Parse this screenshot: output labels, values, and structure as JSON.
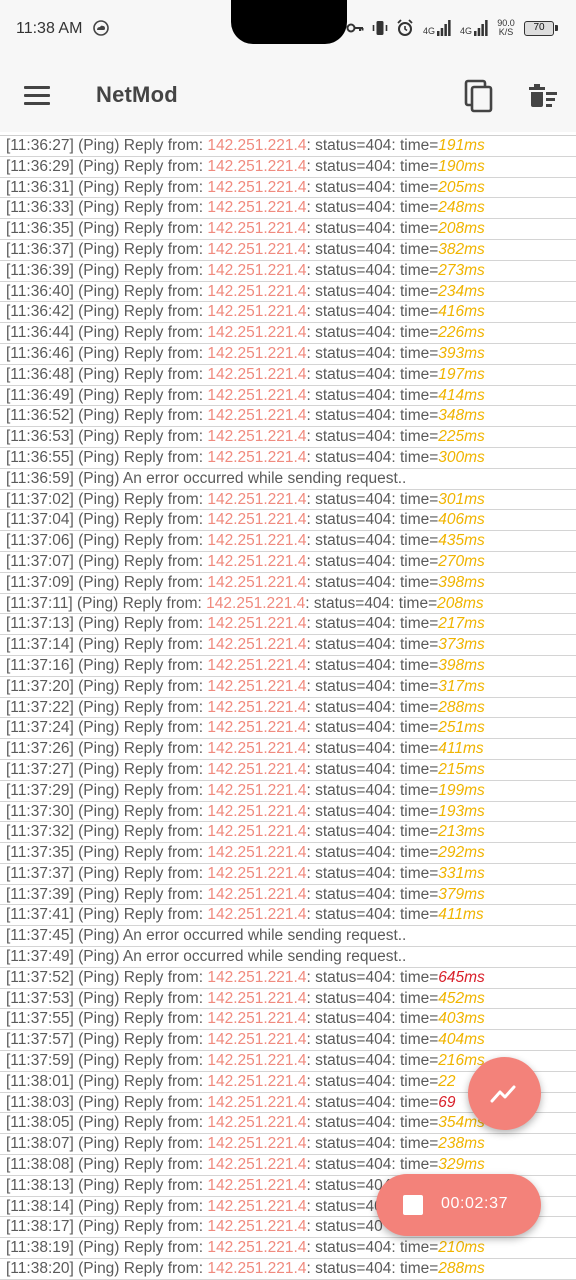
{
  "status_bar": {
    "time": "11:38 AM",
    "net_speed_value": "90.0",
    "net_speed_unit": "K/S",
    "signal1_label": "4G",
    "signal2_label": "4G",
    "battery": "70",
    "icons": [
      "cloud-icon",
      "key-icon",
      "vibrate-icon",
      "alarm-icon",
      "signal-icon",
      "battery-icon"
    ]
  },
  "app_bar": {
    "title": "NetMod",
    "icons": [
      "menu-icon",
      "copy-icon",
      "delete-sweep-icon"
    ]
  },
  "log": {
    "entries": [
      {
        "ts": "[11:36:27]",
        "pre": " (Ping) Reply from: ",
        "ip": "142.251.221.4",
        "mid": ": status=404: time=",
        "ms": "191ms",
        "slow": false
      },
      {
        "ts": "[11:36:29]",
        "pre": " (Ping) Reply from: ",
        "ip": "142.251.221.4",
        "mid": ": status=404: time=",
        "ms": "190ms",
        "slow": false
      },
      {
        "ts": "[11:36:31]",
        "pre": " (Ping) Reply from: ",
        "ip": "142.251.221.4",
        "mid": ": status=404: time=",
        "ms": "205ms",
        "slow": false
      },
      {
        "ts": "[11:36:33]",
        "pre": " (Ping) Reply from: ",
        "ip": "142.251.221.4",
        "mid": ": status=404: time=",
        "ms": "248ms",
        "slow": false
      },
      {
        "ts": "[11:36:35]",
        "pre": " (Ping) Reply from: ",
        "ip": "142.251.221.4",
        "mid": ": status=404: time=",
        "ms": "208ms",
        "slow": false
      },
      {
        "ts": "[11:36:37]",
        "pre": " (Ping) Reply from: ",
        "ip": "142.251.221.4",
        "mid": ": status=404: time=",
        "ms": "382ms",
        "slow": false
      },
      {
        "ts": "[11:36:39]",
        "pre": " (Ping) Reply from: ",
        "ip": "142.251.221.4",
        "mid": ": status=404: time=",
        "ms": "273ms",
        "slow": false
      },
      {
        "ts": "[11:36:40]",
        "pre": " (Ping) Reply from: ",
        "ip": "142.251.221.4",
        "mid": ": status=404: time=",
        "ms": "234ms",
        "slow": false
      },
      {
        "ts": "[11:36:42]",
        "pre": " (Ping) Reply from: ",
        "ip": "142.251.221.4",
        "mid": ": status=404: time=",
        "ms": "416ms",
        "slow": false
      },
      {
        "ts": "[11:36:44]",
        "pre": " (Ping) Reply from: ",
        "ip": "142.251.221.4",
        "mid": ": status=404: time=",
        "ms": "226ms",
        "slow": false
      },
      {
        "ts": "[11:36:46]",
        "pre": " (Ping) Reply from: ",
        "ip": "142.251.221.4",
        "mid": ": status=404: time=",
        "ms": "393ms",
        "slow": false
      },
      {
        "ts": "[11:36:48]",
        "pre": " (Ping) Reply from: ",
        "ip": "142.251.221.4",
        "mid": ": status=404: time=",
        "ms": "197ms",
        "slow": false
      },
      {
        "ts": "[11:36:49]",
        "pre": " (Ping) Reply from: ",
        "ip": "142.251.221.4",
        "mid": ": status=404: time=",
        "ms": "414ms",
        "slow": false
      },
      {
        "ts": "[11:36:52]",
        "pre": " (Ping) Reply from: ",
        "ip": "142.251.221.4",
        "mid": ": status=404: time=",
        "ms": "348ms",
        "slow": false
      },
      {
        "ts": "[11:36:53]",
        "pre": " (Ping) Reply from: ",
        "ip": "142.251.221.4",
        "mid": ": status=404: time=",
        "ms": "225ms",
        "slow": false
      },
      {
        "ts": "[11:36:55]",
        "pre": " (Ping) Reply from: ",
        "ip": "142.251.221.4",
        "mid": ": status=404: time=",
        "ms": "300ms",
        "slow": false
      },
      {
        "ts": "[11:36:59]",
        "pre": " (Ping) An error occurred while sending request..",
        "ip": "",
        "mid": "",
        "ms": "",
        "slow": false
      },
      {
        "ts": "[11:37:02]",
        "pre": " (Ping) Reply from: ",
        "ip": "142.251.221.4",
        "mid": ": status=404: time=",
        "ms": "301ms",
        "slow": false
      },
      {
        "ts": "[11:37:04]",
        "pre": " (Ping) Reply from: ",
        "ip": "142.251.221.4",
        "mid": ": status=404: time=",
        "ms": "406ms",
        "slow": false
      },
      {
        "ts": "[11:37:06]",
        "pre": " (Ping) Reply from: ",
        "ip": "142.251.221.4",
        "mid": ": status=404: time=",
        "ms": "435ms",
        "slow": false
      },
      {
        "ts": "[11:37:07]",
        "pre": " (Ping) Reply from: ",
        "ip": "142.251.221.4",
        "mid": ": status=404: time=",
        "ms": "270ms",
        "slow": false
      },
      {
        "ts": "[11:37:09]",
        "pre": " (Ping) Reply from: ",
        "ip": "142.251.221.4",
        "mid": ": status=404: time=",
        "ms": "398ms",
        "slow": false
      },
      {
        "ts": "[11:37:11]",
        "pre": " (Ping) Reply from: ",
        "ip": "142.251.221.4",
        "mid": ": status=404: time=",
        "ms": "208ms",
        "slow": false
      },
      {
        "ts": "[11:37:13]",
        "pre": " (Ping) Reply from: ",
        "ip": "142.251.221.4",
        "mid": ": status=404: time=",
        "ms": "217ms",
        "slow": false
      },
      {
        "ts": "[11:37:14]",
        "pre": " (Ping) Reply from: ",
        "ip": "142.251.221.4",
        "mid": ": status=404: time=",
        "ms": "373ms",
        "slow": false
      },
      {
        "ts": "[11:37:16]",
        "pre": " (Ping) Reply from: ",
        "ip": "142.251.221.4",
        "mid": ": status=404: time=",
        "ms": "398ms",
        "slow": false
      },
      {
        "ts": "[11:37:20]",
        "pre": " (Ping) Reply from: ",
        "ip": "142.251.221.4",
        "mid": ": status=404: time=",
        "ms": "317ms",
        "slow": false
      },
      {
        "ts": "[11:37:22]",
        "pre": " (Ping) Reply from: ",
        "ip": "142.251.221.4",
        "mid": ": status=404: time=",
        "ms": "288ms",
        "slow": false
      },
      {
        "ts": "[11:37:24]",
        "pre": " (Ping) Reply from: ",
        "ip": "142.251.221.4",
        "mid": ": status=404: time=",
        "ms": "251ms",
        "slow": false
      },
      {
        "ts": "[11:37:26]",
        "pre": " (Ping) Reply from: ",
        "ip": "142.251.221.4",
        "mid": ": status=404: time=",
        "ms": "411ms",
        "slow": false
      },
      {
        "ts": "[11:37:27]",
        "pre": " (Ping) Reply from: ",
        "ip": "142.251.221.4",
        "mid": ": status=404: time=",
        "ms": "215ms",
        "slow": false
      },
      {
        "ts": "[11:37:29]",
        "pre": " (Ping) Reply from: ",
        "ip": "142.251.221.4",
        "mid": ": status=404: time=",
        "ms": "199ms",
        "slow": false
      },
      {
        "ts": "[11:37:30]",
        "pre": " (Ping) Reply from: ",
        "ip": "142.251.221.4",
        "mid": ": status=404: time=",
        "ms": "193ms",
        "slow": false
      },
      {
        "ts": "[11:37:32]",
        "pre": " (Ping) Reply from: ",
        "ip": "142.251.221.4",
        "mid": ": status=404: time=",
        "ms": "213ms",
        "slow": false
      },
      {
        "ts": "[11:37:35]",
        "pre": " (Ping) Reply from: ",
        "ip": "142.251.221.4",
        "mid": ": status=404: time=",
        "ms": "292ms",
        "slow": false
      },
      {
        "ts": "[11:37:37]",
        "pre": " (Ping) Reply from: ",
        "ip": "142.251.221.4",
        "mid": ": status=404: time=",
        "ms": "331ms",
        "slow": false
      },
      {
        "ts": "[11:37:39]",
        "pre": " (Ping) Reply from: ",
        "ip": "142.251.221.4",
        "mid": ": status=404: time=",
        "ms": "379ms",
        "slow": false
      },
      {
        "ts": "[11:37:41]",
        "pre": " (Ping) Reply from: ",
        "ip": "142.251.221.4",
        "mid": ": status=404: time=",
        "ms": "411ms",
        "slow": false
      },
      {
        "ts": "[11:37:45]",
        "pre": " (Ping) An error occurred while sending request..",
        "ip": "",
        "mid": "",
        "ms": "",
        "slow": false
      },
      {
        "ts": "[11:37:49]",
        "pre": " (Ping) An error occurred while sending request..",
        "ip": "",
        "mid": "",
        "ms": "",
        "slow": false
      },
      {
        "ts": "[11:37:52]",
        "pre": " (Ping) Reply from: ",
        "ip": "142.251.221.4",
        "mid": ": status=404: time=",
        "ms": "645ms",
        "slow": true
      },
      {
        "ts": "[11:37:53]",
        "pre": " (Ping) Reply from: ",
        "ip": "142.251.221.4",
        "mid": ": status=404: time=",
        "ms": "452ms",
        "slow": false
      },
      {
        "ts": "[11:37:55]",
        "pre": " (Ping) Reply from: ",
        "ip": "142.251.221.4",
        "mid": ": status=404: time=",
        "ms": "403ms",
        "slow": false
      },
      {
        "ts": "[11:37:57]",
        "pre": " (Ping) Reply from: ",
        "ip": "142.251.221.4",
        "mid": ": status=404: time=",
        "ms": "404ms",
        "slow": false
      },
      {
        "ts": "[11:37:59]",
        "pre": " (Ping) Reply from: ",
        "ip": "142.251.221.4",
        "mid": ": status=404: time=",
        "ms": "216ms",
        "slow": false
      },
      {
        "ts": "[11:38:01]",
        "pre": " (Ping) Reply from: ",
        "ip": "142.251.221.4",
        "mid": ": status=404: time=",
        "ms": "22",
        "slow": false
      },
      {
        "ts": "[11:38:03]",
        "pre": " (Ping) Reply from: ",
        "ip": "142.251.221.4",
        "mid": ": status=404: time=",
        "ms": "69",
        "slow": true
      },
      {
        "ts": "[11:38:05]",
        "pre": " (Ping) Reply from: ",
        "ip": "142.251.221.4",
        "mid": ": status=404: time=",
        "ms": "354ms",
        "slow": false
      },
      {
        "ts": "[11:38:07]",
        "pre": " (Ping) Reply from: ",
        "ip": "142.251.221.4",
        "mid": ": status=404: time=",
        "ms": "238ms",
        "slow": false
      },
      {
        "ts": "[11:38:08]",
        "pre": " (Ping) Reply from: ",
        "ip": "142.251.221.4",
        "mid": ": status=404: time=",
        "ms": "329ms",
        "slow": false
      },
      {
        "ts": "[11:38:13]",
        "pre": " (Ping) Reply from: ",
        "ip": "142.251.221.4",
        "mid": ": status=404: time=",
        "ms": "",
        "slow": false
      },
      {
        "ts": "[11:38:14]",
        "pre": " (Ping) Reply from: ",
        "ip": "142.251.221.4",
        "mid": ": status=40",
        "ms": "",
        "slow": false
      },
      {
        "ts": "[11:38:17]",
        "pre": " (Ping) Reply from: ",
        "ip": "142.251.221.4",
        "mid": ": status=40",
        "ms": "",
        "slow": false
      },
      {
        "ts": "[11:38:19]",
        "pre": " (Ping) Reply from: ",
        "ip": "142.251.221.4",
        "mid": ": status=404: time=",
        "ms": "210ms",
        "slow": false
      },
      {
        "ts": "[11:38:20]",
        "pre": " (Ping) Reply from: ",
        "ip": "142.251.221.4",
        "mid": ": status=404: time=",
        "ms": "288ms",
        "slow": false
      }
    ]
  },
  "fab_graph": {
    "icon": "trending-up-icon"
  },
  "fab_timer": {
    "icon": "stop-icon",
    "elapsed": "00:02:37"
  },
  "colors": {
    "accent": "#f3827a",
    "ip": "#f08a7e",
    "latency": "#f0b400",
    "latency_high": "#d9202a",
    "text": "#5a5a5a",
    "bar_bg": "#f7f7f7"
  }
}
